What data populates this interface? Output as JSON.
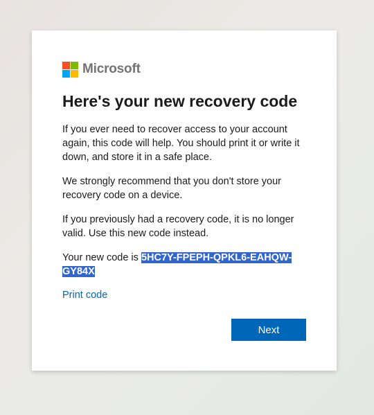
{
  "brand": {
    "name": "Microsoft",
    "colors": [
      "#f25022",
      "#7fba00",
      "#00a4ef",
      "#ffb900"
    ]
  },
  "title": "Here's your new recovery code",
  "paragraphs": {
    "p1": "If you ever need to recover access to your account again, this code will help. You should print it or write it down, and store it in a safe place.",
    "p2": "We strongly recommend that you don't store your recovery code on a device.",
    "p3": "If you previously had a recovery code, it is no longer valid. Use this new code instead.",
    "code_prefix": "Your new code is ",
    "code": "5HC7Y-FPEPH-QPKL6-EAHQW-GY84X"
  },
  "links": {
    "print_code": "Print code"
  },
  "buttons": {
    "next": "Next"
  },
  "theme": {
    "accent": "#0067b8",
    "selection": "#3366cc"
  }
}
